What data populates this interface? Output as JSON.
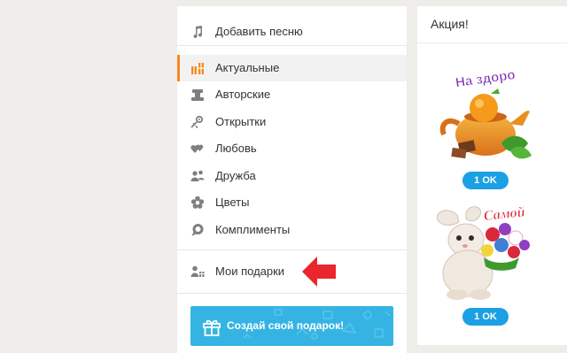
{
  "menu": {
    "add_song": "Добавить песню",
    "categories": [
      {
        "label": "Актуальные",
        "icon": "gift-boxes-icon",
        "active": true
      },
      {
        "label": "Авторские",
        "icon": "author-gifts-icon",
        "active": false
      },
      {
        "label": "Открытки",
        "icon": "postcards-icon",
        "active": false
      },
      {
        "label": "Любовь",
        "icon": "hearts-icon",
        "active": false
      },
      {
        "label": "Дружба",
        "icon": "friends-icon",
        "active": false
      },
      {
        "label": "Цветы",
        "icon": "flower-icon",
        "active": false
      },
      {
        "label": "Комплименты",
        "icon": "speech-bubble-icon",
        "active": false
      }
    ],
    "my_gifts": "Мои подарки",
    "create_gift": "Создай свой подарок!"
  },
  "promo": {
    "title": "Акция!",
    "gifts": [
      {
        "caption": "На здоро",
        "price": "1 OK",
        "picture": "teapot-with-orange-icon"
      },
      {
        "caption": "Самой",
        "price": "1 OK",
        "picture": "bunny-with-flowers-icon"
      }
    ]
  },
  "colors": {
    "accent": "#f78a1f",
    "button_blue": "#35b4e4",
    "price_blue": "#1aa0e3",
    "arrow_red": "#e8262b",
    "page_bg": "#efedea"
  }
}
